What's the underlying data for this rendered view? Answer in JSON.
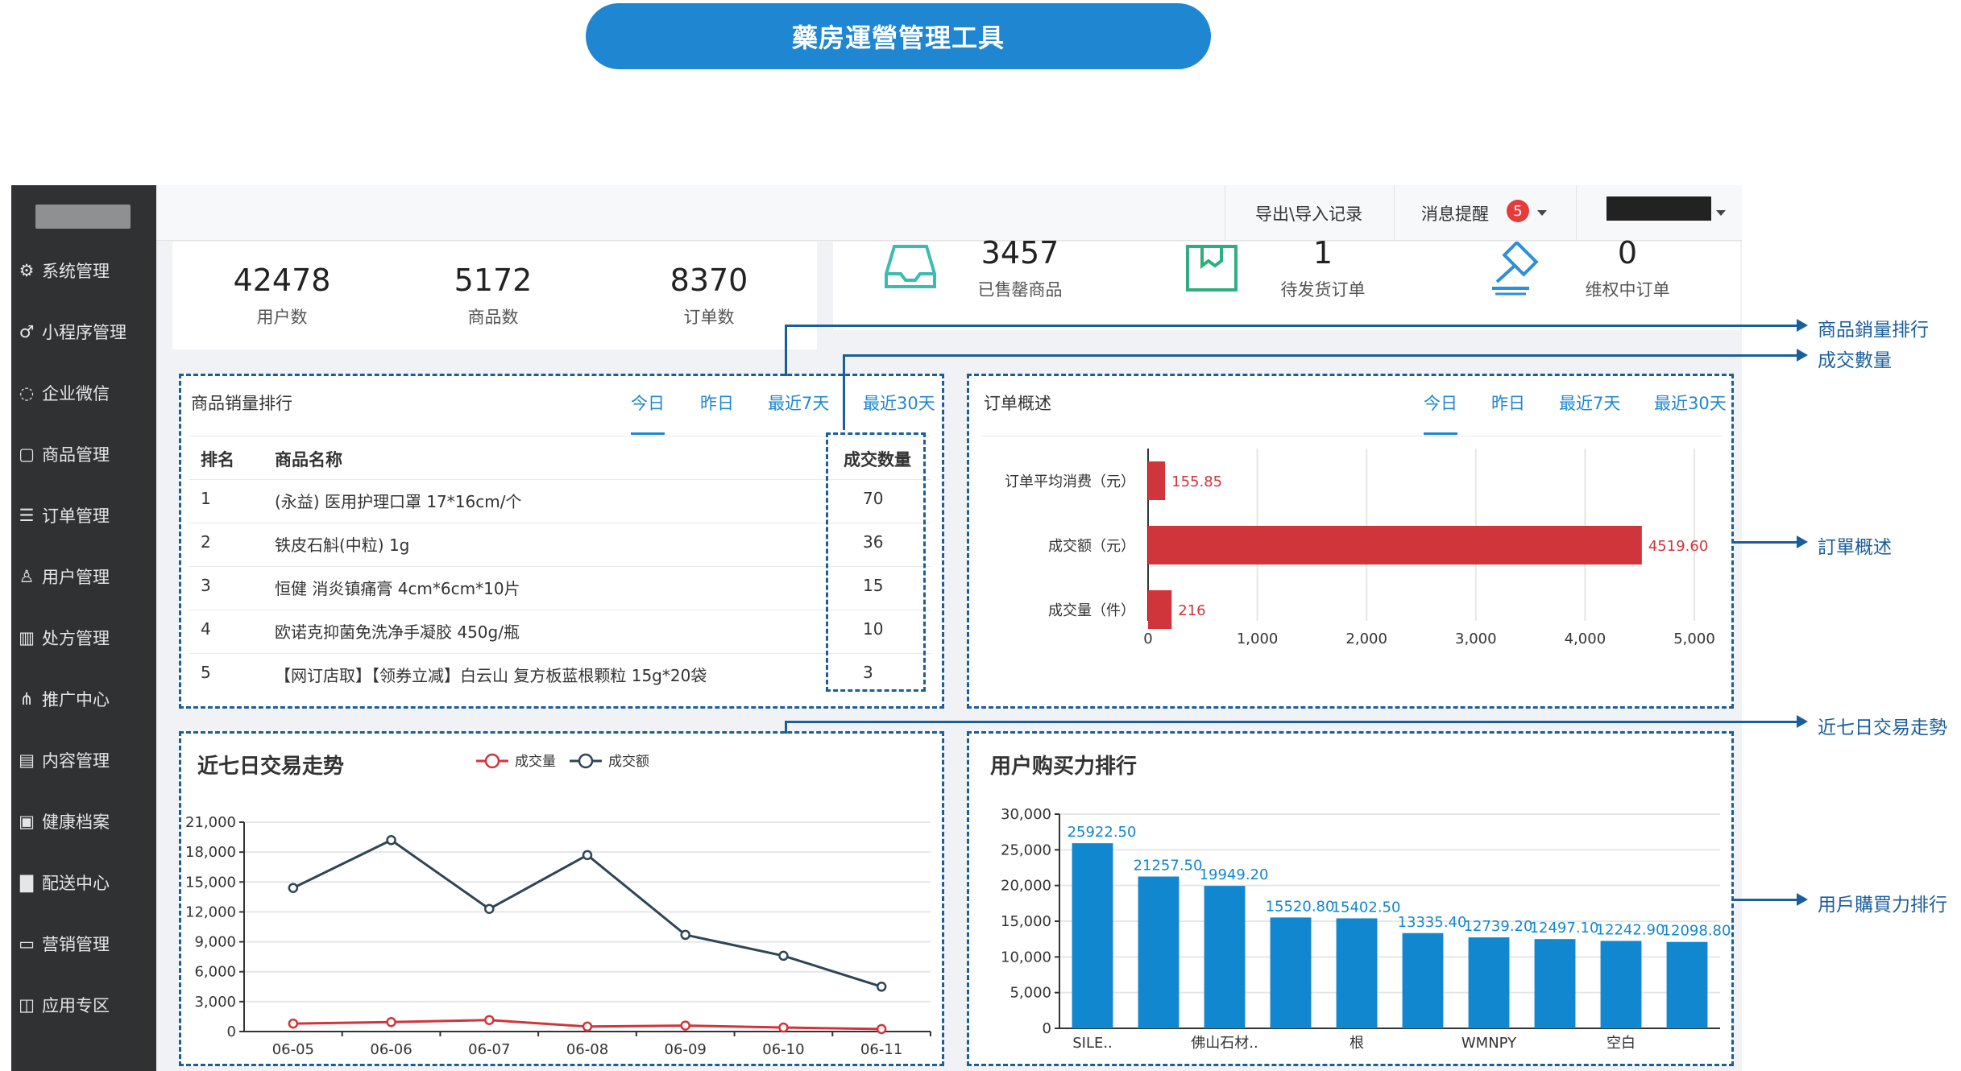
{
  "title": "藥房運營管理工具",
  "sidebar": {
    "items": [
      {
        "icon": "gear-icon",
        "label": "系统管理"
      },
      {
        "icon": "mini-program-icon",
        "label": "小程序管理"
      },
      {
        "icon": "chat-bubble-icon",
        "label": "企业微信"
      },
      {
        "icon": "shopping-bag-icon",
        "label": "商品管理"
      },
      {
        "icon": "order-list-icon",
        "label": "订单管理"
      },
      {
        "icon": "user-icon",
        "label": "用户管理"
      },
      {
        "icon": "prescription-book-icon",
        "label": "处方管理"
      },
      {
        "icon": "network-icon",
        "label": "推广中心"
      },
      {
        "icon": "content-icon",
        "label": "内容管理"
      },
      {
        "icon": "health-record-icon",
        "label": "健康档案"
      },
      {
        "icon": "document-icon",
        "label": "配送中心"
      },
      {
        "icon": "ticket-icon",
        "label": "营销管理"
      },
      {
        "icon": "apps-icon",
        "label": "应用专区"
      }
    ]
  },
  "topbar": {
    "export_label": "导出\\导入记录",
    "messages_label": "消息提醒",
    "messages_count": "5"
  },
  "stats": [
    {
      "value": "42478",
      "label": "用户数"
    },
    {
      "value": "5172",
      "label": "商品数"
    },
    {
      "value": "8370",
      "label": "订单数"
    },
    {
      "value": "3457",
      "label": "已售罄商品",
      "icon": "inbox-tray-icon"
    },
    {
      "value": "1",
      "label": "待发货订单",
      "icon": "package-box-icon"
    },
    {
      "value": "0",
      "label": "维权中订单",
      "icon": "gavel-icon"
    }
  ],
  "sales_rank": {
    "title": "商品销量排行",
    "tabs": [
      "今日",
      "昨日",
      "最近7天",
      "最近30天"
    ],
    "headers": [
      "排名",
      "商品名称",
      "成交数量"
    ],
    "rows": [
      {
        "rank": "1",
        "name": "(永益) 医用护理口罩 17*16cm/个",
        "qty": "70"
      },
      {
        "rank": "2",
        "name": "铁皮石斛(中粒) 1g",
        "qty": "36"
      },
      {
        "rank": "3",
        "name": "恒健 消炎镇痛膏 4cm*6cm*10片",
        "qty": "15"
      },
      {
        "rank": "4",
        "name": "欧诺克抑菌免洗净手凝胶 450g/瓶",
        "qty": "10"
      },
      {
        "rank": "5",
        "name": "【网订店取】【领券立减】白云山 复方板蓝根颗粒 15g*20袋",
        "qty": "3"
      }
    ]
  },
  "order_overview": {
    "title": "订单概述",
    "tabs": [
      "今日",
      "昨日",
      "最近7天",
      "最近30天"
    ]
  },
  "trend": {
    "title": "近七日交易走势"
  },
  "buying_power": {
    "title": "用户购买力排行"
  },
  "annotations": [
    "商品銷量排行",
    "成交數量",
    "訂單概述",
    "近七日交易走勢",
    "用戶購買力排行"
  ],
  "colors": {
    "accent": "#1f87d2",
    "annotation": "#1a5e9b",
    "bar_red": "#d0353b",
    "bar_blue": "#1187cf",
    "sidebar": "#2f3133"
  },
  "chart_data": [
    {
      "type": "bar",
      "orientation": "horizontal",
      "categories": [
        "订单平均消费（元）",
        "成交额（元）",
        "成交量（件）"
      ],
      "values": [
        155.85,
        4519.6,
        216
      ],
      "value_labels": [
        "155.85",
        "4519.60",
        "216"
      ],
      "xlim": [
        0,
        5000
      ],
      "xticks": [
        "0",
        "1,000",
        "2,000",
        "3,000",
        "4,000",
        "5,000"
      ],
      "grid": true
    },
    {
      "type": "line",
      "title": "近七日交易走势",
      "x": [
        "06-05",
        "06-06",
        "06-07",
        "06-08",
        "06-09",
        "06-10",
        "06-11"
      ],
      "series": [
        {
          "name": "成交量",
          "color": "#d0353b",
          "values": [
            800,
            950,
            1150,
            500,
            600,
            400,
            250
          ]
        },
        {
          "name": "成交额",
          "color": "#2f4554",
          "values": [
            14400,
            19200,
            12300,
            17700,
            9700,
            7600,
            4500
          ]
        }
      ],
      "ylim": [
        0,
        21000
      ],
      "yticks": [
        "0",
        "3,000",
        "6,000",
        "9,000",
        "12,000",
        "15,000",
        "18,000",
        "21,000"
      ],
      "legend": "top"
    },
    {
      "type": "bar",
      "title": "用户购买力排行",
      "categories": [
        "SILE..",
        "",
        "佛山石材..",
        "",
        "根",
        "",
        "WMNPY",
        "",
        "空白",
        ""
      ],
      "values": [
        25922.5,
        21257.5,
        19949.2,
        15520.8,
        15402.5,
        13335.4,
        12739.2,
        12497.1,
        12242.9,
        12098.8
      ],
      "value_labels": [
        "25922.50",
        "21257.50",
        "19949.20",
        "15520.80",
        "15402.50",
        "13335.40",
        "12739.20",
        "12497.10",
        "12242.90",
        "12098.80"
      ],
      "ylim": [
        0,
        30000
      ],
      "yticks": [
        "0",
        "5,000",
        "10,000",
        "15,000",
        "20,000",
        "25,000",
        "30,000"
      ],
      "grid": true
    }
  ]
}
